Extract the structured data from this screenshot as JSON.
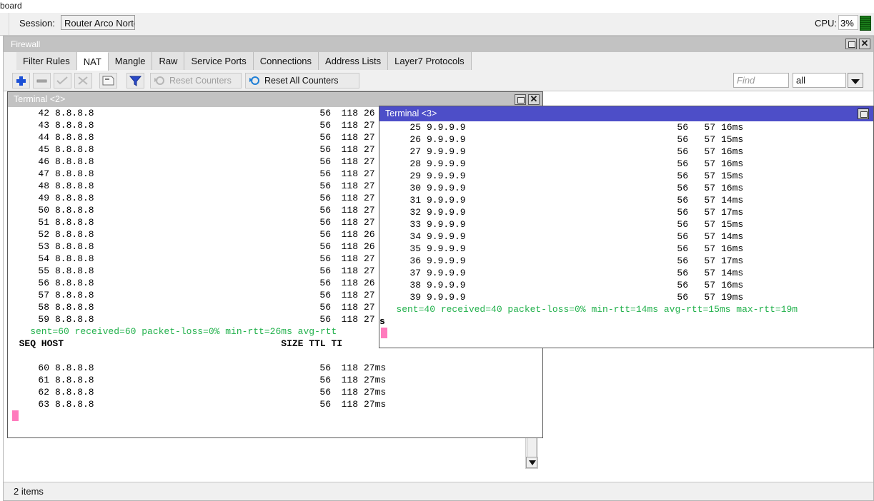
{
  "desktop": {
    "strip_label": "board"
  },
  "session": {
    "label": "Session:",
    "value": "Router Arco Norte",
    "cpu_label": "CPU:",
    "cpu_value": "3%"
  },
  "firewall": {
    "title": "Firewall",
    "restore_glyph": "❐",
    "close_glyph": "✕",
    "tabs": [
      {
        "label": "Filter Rules",
        "active": false
      },
      {
        "label": "NAT",
        "active": true
      },
      {
        "label": "Mangle",
        "active": false
      },
      {
        "label": "Raw",
        "active": false
      },
      {
        "label": "Service Ports",
        "active": false
      },
      {
        "label": "Connections",
        "active": false
      },
      {
        "label": "Address Lists",
        "active": false
      },
      {
        "label": "Layer7 Protocols",
        "active": false
      }
    ],
    "toolbar": {
      "add_icon": "plus-icon",
      "remove_icon": "minus-icon",
      "enable_icon": "check-icon",
      "disable_icon": "cross-icon",
      "comment_icon": "comment-icon",
      "filter_icon": "funnel-icon",
      "reset_counters_label": "Reset Counters",
      "reset_all_counters_label": "Reset All Counters",
      "find_placeholder": "Find",
      "filter_value": "all",
      "dropdown_glyph": "⬇"
    },
    "status": "2 items"
  },
  "terminal2": {
    "title": "Terminal <2>",
    "columns": {
      "seq": "SEQ",
      "host": "HOST",
      "size": "SIZE",
      "ttl": "TTL",
      "time": "TIME"
    },
    "rows_top": [
      {
        "seq": "42",
        "host": "8.8.8.8",
        "size": "56",
        "ttl": "118",
        "time": "26"
      },
      {
        "seq": "43",
        "host": "8.8.8.8",
        "size": "56",
        "ttl": "118",
        "time": "27"
      },
      {
        "seq": "44",
        "host": "8.8.8.8",
        "size": "56",
        "ttl": "118",
        "time": "27"
      },
      {
        "seq": "45",
        "host": "8.8.8.8",
        "size": "56",
        "ttl": "118",
        "time": "27"
      },
      {
        "seq": "46",
        "host": "8.8.8.8",
        "size": "56",
        "ttl": "118",
        "time": "27"
      },
      {
        "seq": "47",
        "host": "8.8.8.8",
        "size": "56",
        "ttl": "118",
        "time": "27"
      },
      {
        "seq": "48",
        "host": "8.8.8.8",
        "size": "56",
        "ttl": "118",
        "time": "27"
      },
      {
        "seq": "49",
        "host": "8.8.8.8",
        "size": "56",
        "ttl": "118",
        "time": "27"
      },
      {
        "seq": "50",
        "host": "8.8.8.8",
        "size": "56",
        "ttl": "118",
        "time": "27"
      },
      {
        "seq": "51",
        "host": "8.8.8.8",
        "size": "56",
        "ttl": "118",
        "time": "27"
      },
      {
        "seq": "52",
        "host": "8.8.8.8",
        "size": "56",
        "ttl": "118",
        "time": "26"
      },
      {
        "seq": "53",
        "host": "8.8.8.8",
        "size": "56",
        "ttl": "118",
        "time": "26"
      },
      {
        "seq": "54",
        "host": "8.8.8.8",
        "size": "56",
        "ttl": "118",
        "time": "27"
      },
      {
        "seq": "55",
        "host": "8.8.8.8",
        "size": "56",
        "ttl": "118",
        "time": "27"
      },
      {
        "seq": "56",
        "host": "8.8.8.8",
        "size": "56",
        "ttl": "118",
        "time": "26"
      },
      {
        "seq": "57",
        "host": "8.8.8.8",
        "size": "56",
        "ttl": "118",
        "time": "27"
      },
      {
        "seq": "58",
        "host": "8.8.8.8",
        "size": "56",
        "ttl": "118",
        "time": "27"
      },
      {
        "seq": "59",
        "host": "8.8.8.8",
        "size": "56",
        "ttl": "118",
        "time": "27"
      }
    ],
    "summary": "    sent=60 received=60 packet-loss=0% min-rtt=26ms avg-rtt",
    "header_line": "  SEQ HOST                                       SIZE TTL TI",
    "rows_bottom": [
      {
        "seq": "60",
        "host": "8.8.8.8",
        "size": "56",
        "ttl": "118",
        "time": "27ms"
      },
      {
        "seq": "61",
        "host": "8.8.8.8",
        "size": "56",
        "ttl": "118",
        "time": "27ms"
      },
      {
        "seq": "62",
        "host": "8.8.8.8",
        "size": "56",
        "ttl": "118",
        "time": "27ms"
      },
      {
        "seq": "63",
        "host": "8.8.8.8",
        "size": "56",
        "ttl": "118",
        "time": "27ms"
      }
    ]
  },
  "terminal3": {
    "title": "Terminal <3>",
    "rows": [
      {
        "seq": "25",
        "host": "9.9.9.9",
        "size": "56",
        "ttl": "57",
        "time": "16ms"
      },
      {
        "seq": "26",
        "host": "9.9.9.9",
        "size": "56",
        "ttl": "57",
        "time": "15ms"
      },
      {
        "seq": "27",
        "host": "9.9.9.9",
        "size": "56",
        "ttl": "57",
        "time": "16ms"
      },
      {
        "seq": "28",
        "host": "9.9.9.9",
        "size": "56",
        "ttl": "57",
        "time": "16ms"
      },
      {
        "seq": "29",
        "host": "9.9.9.9",
        "size": "56",
        "ttl": "57",
        "time": "15ms"
      },
      {
        "seq": "30",
        "host": "9.9.9.9",
        "size": "56",
        "ttl": "57",
        "time": "16ms"
      },
      {
        "seq": "31",
        "host": "9.9.9.9",
        "size": "56",
        "ttl": "57",
        "time": "14ms"
      },
      {
        "seq": "32",
        "host": "9.9.9.9",
        "size": "56",
        "ttl": "57",
        "time": "17ms"
      },
      {
        "seq": "33",
        "host": "9.9.9.9",
        "size": "56",
        "ttl": "57",
        "time": "15ms"
      },
      {
        "seq": "34",
        "host": "9.9.9.9",
        "size": "56",
        "ttl": "57",
        "time": "14ms"
      },
      {
        "seq": "35",
        "host": "9.9.9.9",
        "size": "56",
        "ttl": "57",
        "time": "16ms"
      },
      {
        "seq": "36",
        "host": "9.9.9.9",
        "size": "56",
        "ttl": "57",
        "time": "17ms"
      },
      {
        "seq": "37",
        "host": "9.9.9.9",
        "size": "56",
        "ttl": "57",
        "time": "14ms"
      },
      {
        "seq": "38",
        "host": "9.9.9.9",
        "size": "56",
        "ttl": "57",
        "time": "16ms"
      },
      {
        "seq": "39",
        "host": "9.9.9.9",
        "size": "56",
        "ttl": "57",
        "time": "19ms"
      }
    ],
    "summary_line1": "   sent=40 received=40 packet-loss=0% min-rtt=14ms avg-rtt=15ms max-rtt=19m",
    "summary_line2": "s"
  },
  "colors": {
    "title_active": "#4d4ec8",
    "title_inactive": "#c2c2c2",
    "terminal_green": "#22b14c",
    "cursor_pink": "#ff7bbd",
    "cpu_green": "#0b6b0b"
  }
}
